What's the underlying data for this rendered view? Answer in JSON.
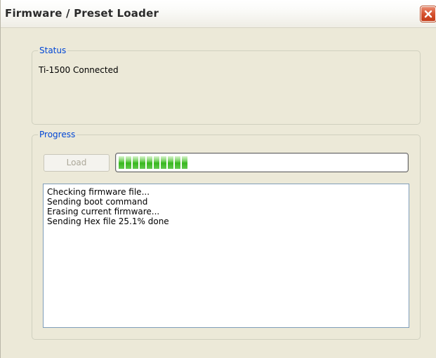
{
  "window": {
    "title": "Firmware / Preset Loader"
  },
  "status": {
    "legend": "Status",
    "text": "Ti-1500 Connected"
  },
  "progress": {
    "legend": "Progress",
    "load_label": "Load",
    "load_enabled": false,
    "bar_percent": 25.1,
    "bar_color": "#37b81d"
  },
  "log": {
    "lines": [
      "Checking firmware file...",
      "Sending boot command",
      "Erasing current firmware...",
      "Sending Hex file 25.1% done"
    ]
  },
  "colors": {
    "legend_text": "#0046d5",
    "window_bg": "#ece9d8",
    "close_button": "#d5522f"
  },
  "icons": {
    "close": "close-icon"
  }
}
